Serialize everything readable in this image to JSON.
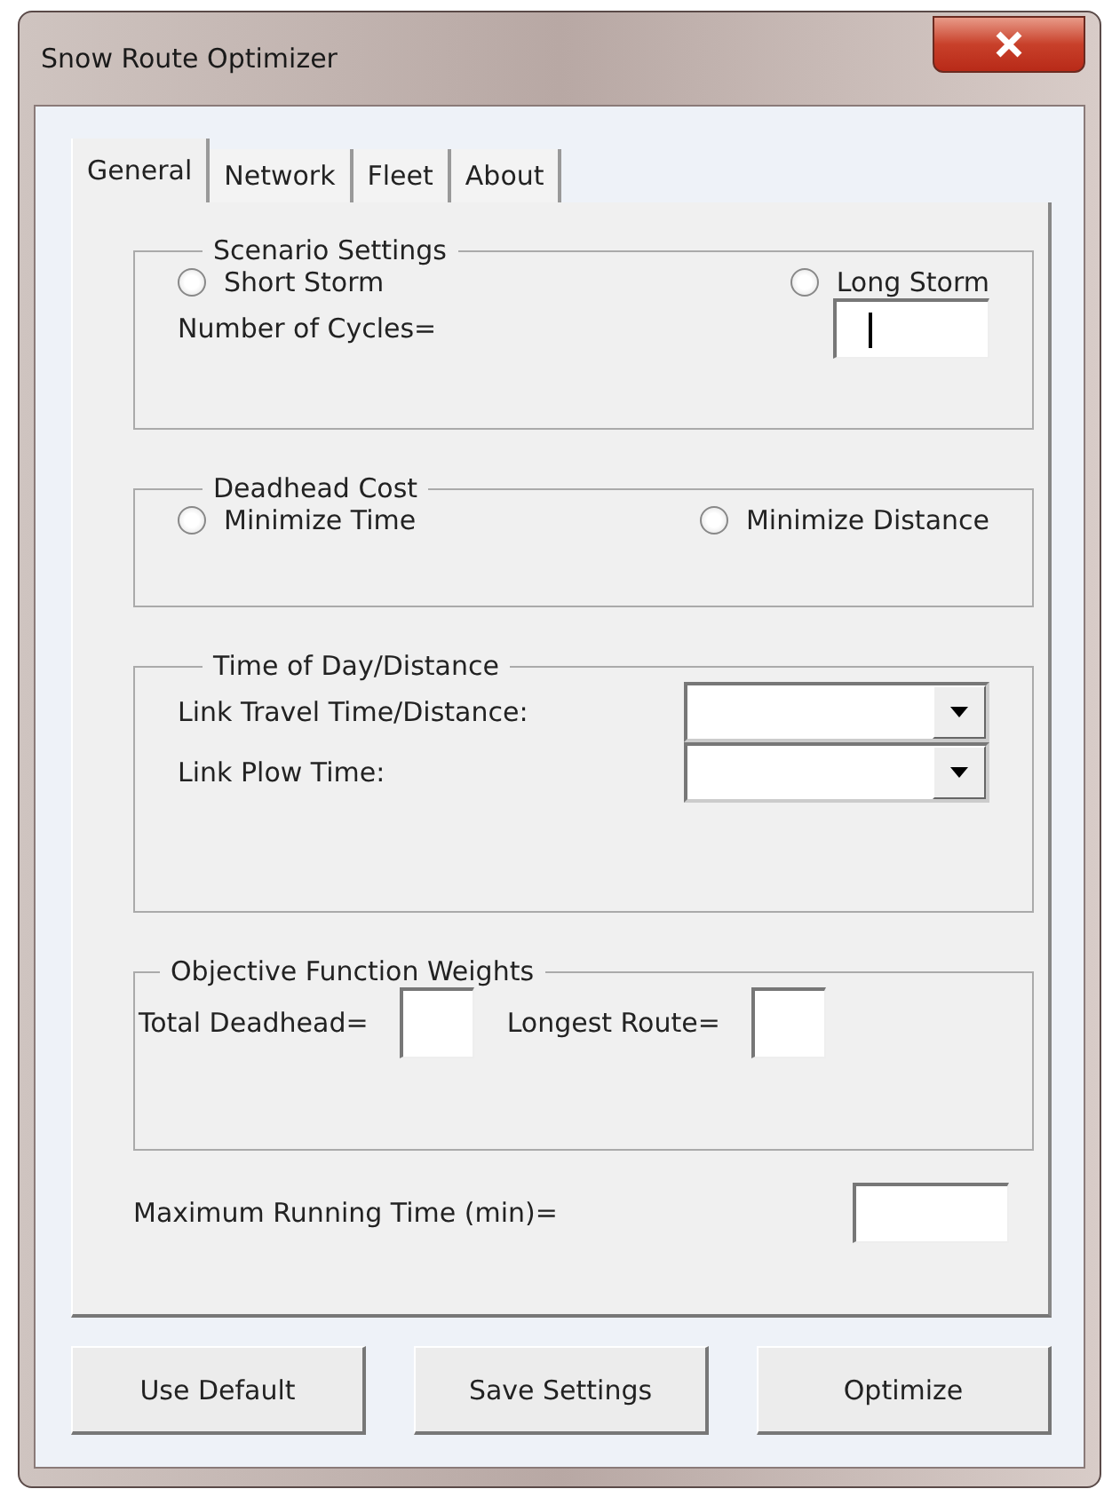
{
  "window": {
    "title": "Snow Route Optimizer"
  },
  "tabs": [
    {
      "label": "General",
      "selected": true
    },
    {
      "label": "Network",
      "selected": false
    },
    {
      "label": "Fleet",
      "selected": false
    },
    {
      "label": "About",
      "selected": false
    }
  ],
  "scenario": {
    "title": "Scenario Settings",
    "options": [
      {
        "label": "Short Storm",
        "selected": false
      },
      {
        "label": "Long Storm",
        "selected": false
      }
    ],
    "cycles_label": "Number of Cycles=",
    "cycles_focused": true
  },
  "deadhead": {
    "title": "Deadhead Cost",
    "options": [
      {
        "label": "Minimize Time",
        "selected": false
      },
      {
        "label": "Minimize Distance",
        "selected": false
      }
    ]
  },
  "time_of_day": {
    "title": "Time of Day/Distance",
    "fields": [
      {
        "label": "Link Travel Time/Distance:"
      },
      {
        "label": "Link Plow Time:"
      }
    ]
  },
  "weights": {
    "title": "Objective Function Weights",
    "fields": [
      {
        "label": "Total Deadhead="
      },
      {
        "label": "Longest Route="
      }
    ]
  },
  "max_running": {
    "label": "Maximum Running Time (min)="
  },
  "buttons": [
    "Use Default",
    "Save Settings",
    "Optimize"
  ]
}
